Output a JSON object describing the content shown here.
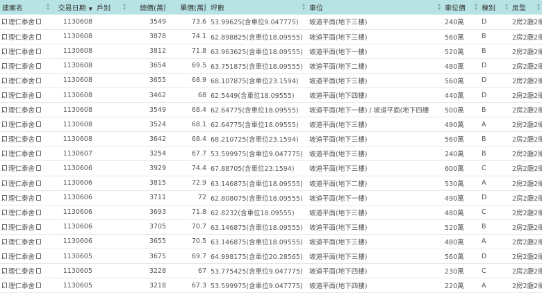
{
  "columns": [
    {
      "label": "建案名",
      "key": "name"
    },
    {
      "label": "交易日期",
      "key": "date"
    },
    {
      "label": "戶別",
      "key": "unit"
    },
    {
      "label": "總價(萬)",
      "key": "total"
    },
    {
      "label": "單價(萬)",
      "key": "unit_price"
    },
    {
      "label": "坪數",
      "key": "area"
    },
    {
      "label": "車位",
      "key": "parking"
    },
    {
      "label": "車位價",
      "key": "parking_price"
    },
    {
      "label": "棟別",
      "key": "building"
    },
    {
      "label": "房型",
      "key": "layout"
    }
  ],
  "rows": [
    {
      "name": "理仁泰舍",
      "date": "1130608",
      "unit": "",
      "total": "3549",
      "unit_price": "73.6",
      "area": "53.99625(含車位9.047775)",
      "parking": "坡道平面(地下三樓)",
      "parking_price": "240萬",
      "building": "D",
      "layout": "2房2廳2衛"
    },
    {
      "name": "理仁泰舍",
      "date": "1130608",
      "unit": "",
      "total": "3878",
      "unit_price": "74.1",
      "area": "62.898825(含車位18.09555)",
      "parking": "坡道平面(地下三樓)",
      "parking_price": "560萬",
      "building": "B",
      "layout": "2房2廳2衛"
    },
    {
      "name": "理仁泰舍",
      "date": "1130608",
      "unit": "",
      "total": "3812",
      "unit_price": "71.8",
      "area": "63.963625(含車位18.09555)",
      "parking": "坡道平面(地下一樓)",
      "parking_price": "520萬",
      "building": "B",
      "layout": "2房2廳2衛"
    },
    {
      "name": "理仁泰舍",
      "date": "1130608",
      "unit": "",
      "total": "3654",
      "unit_price": "69.5",
      "area": "63.751875(含車位18.09555)",
      "parking": "坡道平面(地下二樓)",
      "parking_price": "480萬",
      "building": "D",
      "layout": "2房2廳2衛"
    },
    {
      "name": "理仁泰舍",
      "date": "1130608",
      "unit": "",
      "total": "3655",
      "unit_price": "68.9",
      "area": "68.107875(含車位23.1594)",
      "parking": "坡道平面(地下三樓)",
      "parking_price": "560萬",
      "building": "D",
      "layout": "2房2廳2衛"
    },
    {
      "name": "理仁泰舍",
      "date": "1130608",
      "unit": "",
      "total": "3462",
      "unit_price": "68",
      "area": "62.5449(含車位18.09555)",
      "parking": "坡道平面(地下四樓)",
      "parking_price": "440萬",
      "building": "D",
      "layout": "2房2廳2衛"
    },
    {
      "name": "理仁泰舍",
      "date": "1130608",
      "unit": "",
      "total": "3549",
      "unit_price": "68.4",
      "area": "62.64775(含車位18.09555)",
      "parking": "坡道平面(地下一樓) / 坡道平面(地下四樓",
      "parking_price": "500萬",
      "building": "B",
      "layout": "2房2廳2衛"
    },
    {
      "name": "理仁泰舍",
      "date": "1130608",
      "unit": "",
      "total": "3524",
      "unit_price": "68.1",
      "area": "62.64775(含車位18.09555)",
      "parking": "坡道平面(地下三樓)",
      "parking_price": "490萬",
      "building": "A",
      "layout": "2房2廳2衛"
    },
    {
      "name": "理仁泰舍",
      "date": "1130608",
      "unit": "",
      "total": "3642",
      "unit_price": "68.4",
      "area": "68.210725(含車位23.1594)",
      "parking": "坡道平面(地下三樓)",
      "parking_price": "560萬",
      "building": "B",
      "layout": "2房2廳2衛"
    },
    {
      "name": "理仁泰舍",
      "date": "1130607",
      "unit": "",
      "total": "3254",
      "unit_price": "67.7",
      "area": "53.599975(含車位9.047775)",
      "parking": "坡道平面(地下三樓)",
      "parking_price": "240萬",
      "building": "B",
      "layout": "2房2廳2衛"
    },
    {
      "name": "理仁泰舍",
      "date": "1130606",
      "unit": "",
      "total": "3929",
      "unit_price": "74.4",
      "area": "67.88705(含車位23.1594)",
      "parking": "坡道平面(地下三樓)",
      "parking_price": "600萬",
      "building": "C",
      "layout": "2房2廳2衛"
    },
    {
      "name": "理仁泰舍",
      "date": "1130606",
      "unit": "",
      "total": "3815",
      "unit_price": "72.9",
      "area": "63.146875(含車位18.09555)",
      "parking": "坡道平面(地下二樓)",
      "parking_price": "530萬",
      "building": "A",
      "layout": "2房2廳2衛"
    },
    {
      "name": "理仁泰舍",
      "date": "1130606",
      "unit": "",
      "total": "3711",
      "unit_price": "72",
      "area": "62.808075(含車位18.09555)",
      "parking": "坡道平面(地下一樓)",
      "parking_price": "490萬",
      "building": "D",
      "layout": "2房2廳2衛"
    },
    {
      "name": "理仁泰舍",
      "date": "1130606",
      "unit": "",
      "total": "3693",
      "unit_price": "71.8",
      "area": "62.8232(含車位18.09555)",
      "parking": "坡道平面(地下三樓)",
      "parking_price": "480萬",
      "building": "C",
      "layout": "2房2廳2衛"
    },
    {
      "name": "理仁泰舍",
      "date": "1130606",
      "unit": "",
      "total": "3705",
      "unit_price": "70.7",
      "area": "63.146875(含車位18.09555)",
      "parking": "坡道平面(地下三樓)",
      "parking_price": "520萬",
      "building": "B",
      "layout": "2房2廳2衛"
    },
    {
      "name": "理仁泰舍",
      "date": "1130606",
      "unit": "",
      "total": "3655",
      "unit_price": "70.5",
      "area": "63.146875(含車位18.09555)",
      "parking": "坡道平面(地下三樓)",
      "parking_price": "480萬",
      "building": "A",
      "layout": "2房2廳2衛"
    },
    {
      "name": "理仁泰舍",
      "date": "1130605",
      "unit": "",
      "total": "3675",
      "unit_price": "69.7",
      "area": "64.998175(含車位20.28565)",
      "parking": "坡道平面(地下三樓)",
      "parking_price": "560萬",
      "building": "D",
      "layout": "2房2廳2衛"
    },
    {
      "name": "理仁泰舍",
      "date": "1130605",
      "unit": "",
      "total": "3228",
      "unit_price": "67",
      "area": "53.775425(含車位9.047775)",
      "parking": "坡道平面(地下四樓)",
      "parking_price": "230萬",
      "building": "C",
      "layout": "2房2廳2衛"
    },
    {
      "name": "理仁泰舍",
      "date": "1130605",
      "unit": "",
      "total": "3218",
      "unit_price": "67.3",
      "area": "53.599975(含車位9.047775)",
      "parking": "坡道平面(地下四樓)",
      "parking_price": "220萬",
      "building": "A",
      "layout": "2房2廳2衛"
    }
  ]
}
